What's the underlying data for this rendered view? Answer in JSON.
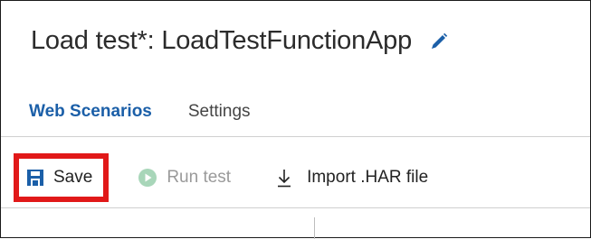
{
  "header": {
    "title": "Load test*: LoadTestFunctionApp",
    "edit_icon": "pencil-icon"
  },
  "tabs": [
    {
      "label": "Web Scenarios",
      "active": true
    },
    {
      "label": "Settings",
      "active": false
    }
  ],
  "toolbar": {
    "save_label": "Save",
    "save_icon": "floppy-disk-icon",
    "run_label": "Run test",
    "run_icon": "play-circle-icon",
    "run_enabled": false,
    "import_label": "Import .HAR file",
    "import_icon": "download-arrow-icon"
  },
  "colors": {
    "accent": "#1b5fa8",
    "highlight": "#e11919",
    "disabled": "#9a9a9a",
    "run_icon_fill": "#a8d6b9"
  }
}
